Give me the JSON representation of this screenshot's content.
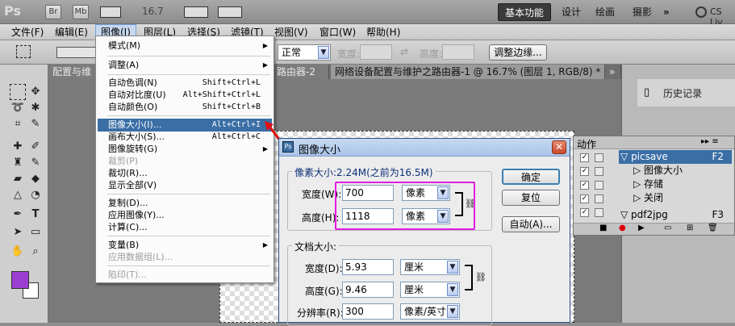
{
  "appbar": {
    "logo": "Ps",
    "br_label": "Br",
    "mb_label": "Mb",
    "zoom": "16.7",
    "workspace_active": "基本功能",
    "workspaces": [
      "设计",
      "绘画",
      "摄影"
    ],
    "more": "»",
    "cslive": "CS Liv"
  },
  "menubar": {
    "items": [
      "文件(F)",
      "编辑(E)",
      "图像(I)",
      "图层(L)",
      "选择(S)",
      "滤镜(T)",
      "视图(V)",
      "窗口(W)",
      "帮助(H)"
    ]
  },
  "options": {
    "mode_value": "正常",
    "width_label": "宽度:",
    "height_label": "高度:",
    "refine_edge": "调整边缘..."
  },
  "tabs": {
    "tab1": "配置与维护",
    "tab2": "路由器-2 ⊠",
    "tab3": "网络设备配置与维护之路由器-1 @ 16.7% (图层 1, RGB/8) * ⊠",
    "more": "»"
  },
  "image_menu": {
    "items": [
      {
        "label": "模式(M)",
        "shortcut": "",
        "submenu": true
      },
      {
        "label": "调整(A)",
        "shortcut": "",
        "submenu": true
      },
      {
        "label": "自动色调(N)",
        "shortcut": "Shift+Ctrl+L"
      },
      {
        "label": "自动对比度(U)",
        "shortcut": "Alt+Shift+Ctrl+L"
      },
      {
        "label": "自动颜色(O)",
        "shortcut": "Shift+Ctrl+B"
      },
      {
        "label": "图像大小(I)...",
        "shortcut": "Alt+Ctrl+I"
      },
      {
        "label": "画布大小(S)...",
        "shortcut": "Alt+Ctrl+C"
      },
      {
        "label": "图像旋转(G)",
        "shortcut": "",
        "submenu": true
      },
      {
        "label": "裁剪(P)",
        "shortcut": ""
      },
      {
        "label": "裁切(R)...",
        "shortcut": ""
      },
      {
        "label": "显示全部(V)",
        "shortcut": ""
      },
      {
        "label": "复制(D)...",
        "shortcut": ""
      },
      {
        "label": "应用图像(Y)...",
        "shortcut": ""
      },
      {
        "label": "计算(C)...",
        "shortcut": ""
      },
      {
        "label": "变量(B)",
        "shortcut": "",
        "submenu": true
      },
      {
        "label": "应用数据组(L)...",
        "shortcut": ""
      },
      {
        "label": "陷印(T)...",
        "shortcut": ""
      }
    ]
  },
  "history_panel": {
    "title": "历史记录"
  },
  "actions_panel": {
    "tab": "动作",
    "rows": [
      {
        "label": "picsave",
        "key": "F2"
      },
      {
        "label": "图像大小"
      },
      {
        "label": "存储"
      },
      {
        "label": "关闭"
      },
      {
        "label": "pdf2jpg",
        "key": "F3"
      }
    ]
  },
  "dialog": {
    "title": "图像大小",
    "pixel_group": "像素大小:2.24M(之前为16.5M)",
    "width_label": "宽度(W):",
    "width_value": "700",
    "width_unit": "像素",
    "height_label": "高度(H):",
    "height_value": "1118",
    "height_unit": "像素",
    "doc_group": "文档大小:",
    "doc_width_label": "宽度(D):",
    "doc_width_value": "5.93",
    "doc_width_unit": "厘米",
    "doc_height_label": "高度(G):",
    "doc_height_value": "9.46",
    "doc_height_unit": "厘米",
    "res_label": "分辨率(R):",
    "res_value": "300",
    "res_unit": "像素/英寸",
    "ok": "确定",
    "reset": "复位",
    "auto": "自动(A)..."
  },
  "colors": {
    "foreground": "#9b3fd3",
    "highlight": "#e11ee1",
    "menu_selected": "#3a6ea5"
  }
}
